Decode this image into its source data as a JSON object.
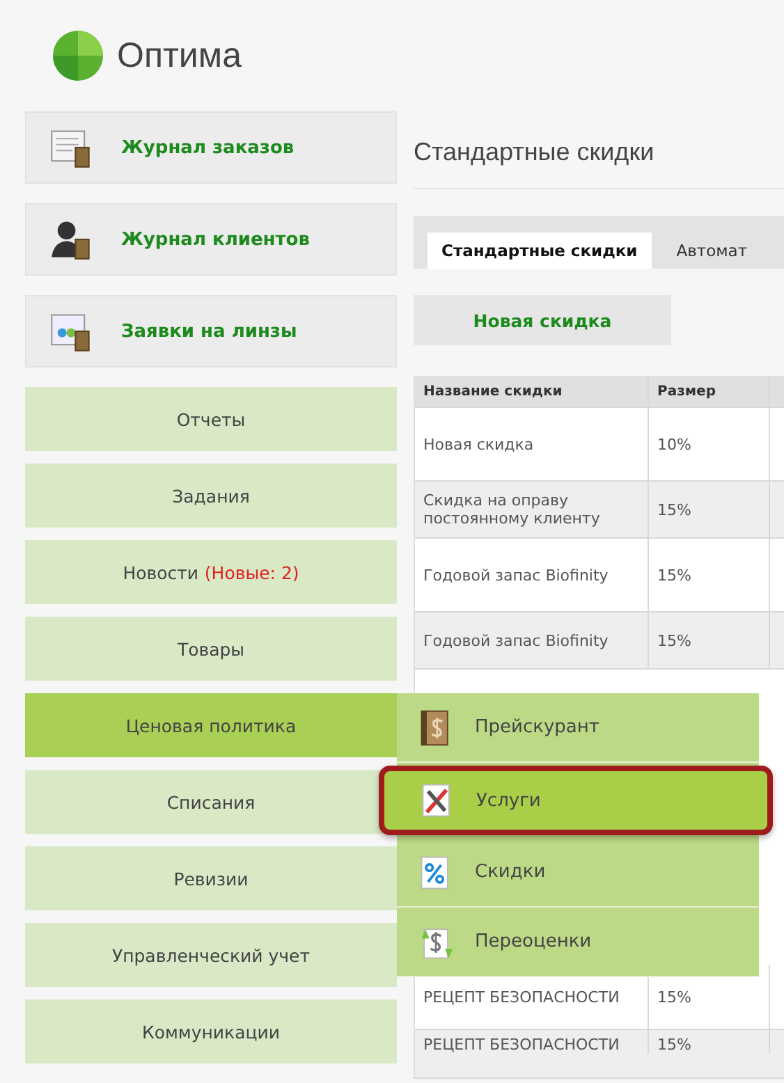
{
  "logo": {
    "text": "Оптима"
  },
  "sidebar": {
    "items": [
      {
        "kind": "large",
        "label": "Журнал заказов",
        "selected": false
      },
      {
        "kind": "large",
        "label": "Журнал клиентов",
        "selected": false
      },
      {
        "kind": "large",
        "label": "Заявки на линзы",
        "selected": false
      },
      {
        "kind": "plain",
        "label": "Отчеты",
        "selected": false
      },
      {
        "kind": "plain",
        "label": "Задания",
        "selected": false
      },
      {
        "kind": "plain",
        "label": "Новости",
        "badge": "(Новые: 2)",
        "selected": false
      },
      {
        "kind": "plain",
        "label": "Товары",
        "selected": false
      },
      {
        "kind": "plain",
        "label": "Ценовая политика",
        "selected": true
      },
      {
        "kind": "plain",
        "label": "Списания",
        "selected": false
      },
      {
        "kind": "plain",
        "label": "Ревизии",
        "selected": false
      },
      {
        "kind": "plain",
        "label": "Управленческий учет",
        "selected": false
      },
      {
        "kind": "plain",
        "label": "Коммуникации",
        "selected": false
      }
    ]
  },
  "submenu": {
    "items": [
      {
        "label": "Прейскурант",
        "selected": false,
        "annotated": false
      },
      {
        "label": "Услуги",
        "selected": true,
        "annotated": true
      },
      {
        "label": "Скидки",
        "selected": false,
        "annotated": false
      },
      {
        "label": "Переоценки",
        "selected": false,
        "annotated": false
      }
    ]
  },
  "page_title": "Стандартные скидки",
  "tabs": [
    {
      "label": "Стандартные скидки",
      "selected": true
    },
    {
      "label": "Автомат",
      "selected": false
    }
  ],
  "new_button": "Новая скидка",
  "table": {
    "columns": [
      "Название скидки",
      "Размер"
    ],
    "rows": [
      {
        "name": "Новая скидка",
        "size": "10%"
      },
      {
        "name": "Скидка на оправу постоянному клиенту",
        "size": "15%"
      },
      {
        "name": "Годовой запас Biofinity",
        "size": "15%"
      },
      {
        "name": "Годовой запас Biofinity",
        "size": "15%"
      }
    ],
    "rows_below_menu": [
      {
        "name": "РЕЦЕПТ БЕЗОПАСНОСТИ",
        "size": "15%"
      },
      {
        "name": "РЕЦЕПТ БЕЗОПАСНОСТИ",
        "size": "15%"
      }
    ]
  }
}
